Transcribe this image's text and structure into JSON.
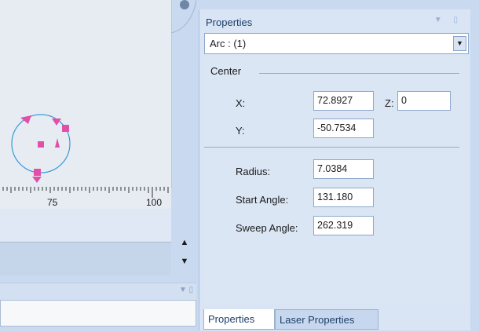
{
  "canvas": {
    "ruler_labels": [
      "75",
      "100"
    ],
    "accent": "#e14fa8",
    "circle_color": "#3a9ad6"
  },
  "properties_panel": {
    "title": "Properties",
    "selection": "Arc : (1)",
    "center_section": "Center",
    "x_label": "X:",
    "x_value": "72.8927",
    "z_label": "Z:",
    "z_value": "0",
    "y_label": "Y:",
    "y_value": "-50.7534",
    "radius_label": "Radius:",
    "radius_value": "7.0384",
    "start_angle_label": "Start Angle:",
    "start_angle_value": "131.180",
    "sweep_angle_label": "Sweep Angle:",
    "sweep_angle_value": "262.319"
  },
  "tabs": [
    {
      "label": "Properties"
    },
    {
      "label": "Laser Properties"
    }
  ]
}
